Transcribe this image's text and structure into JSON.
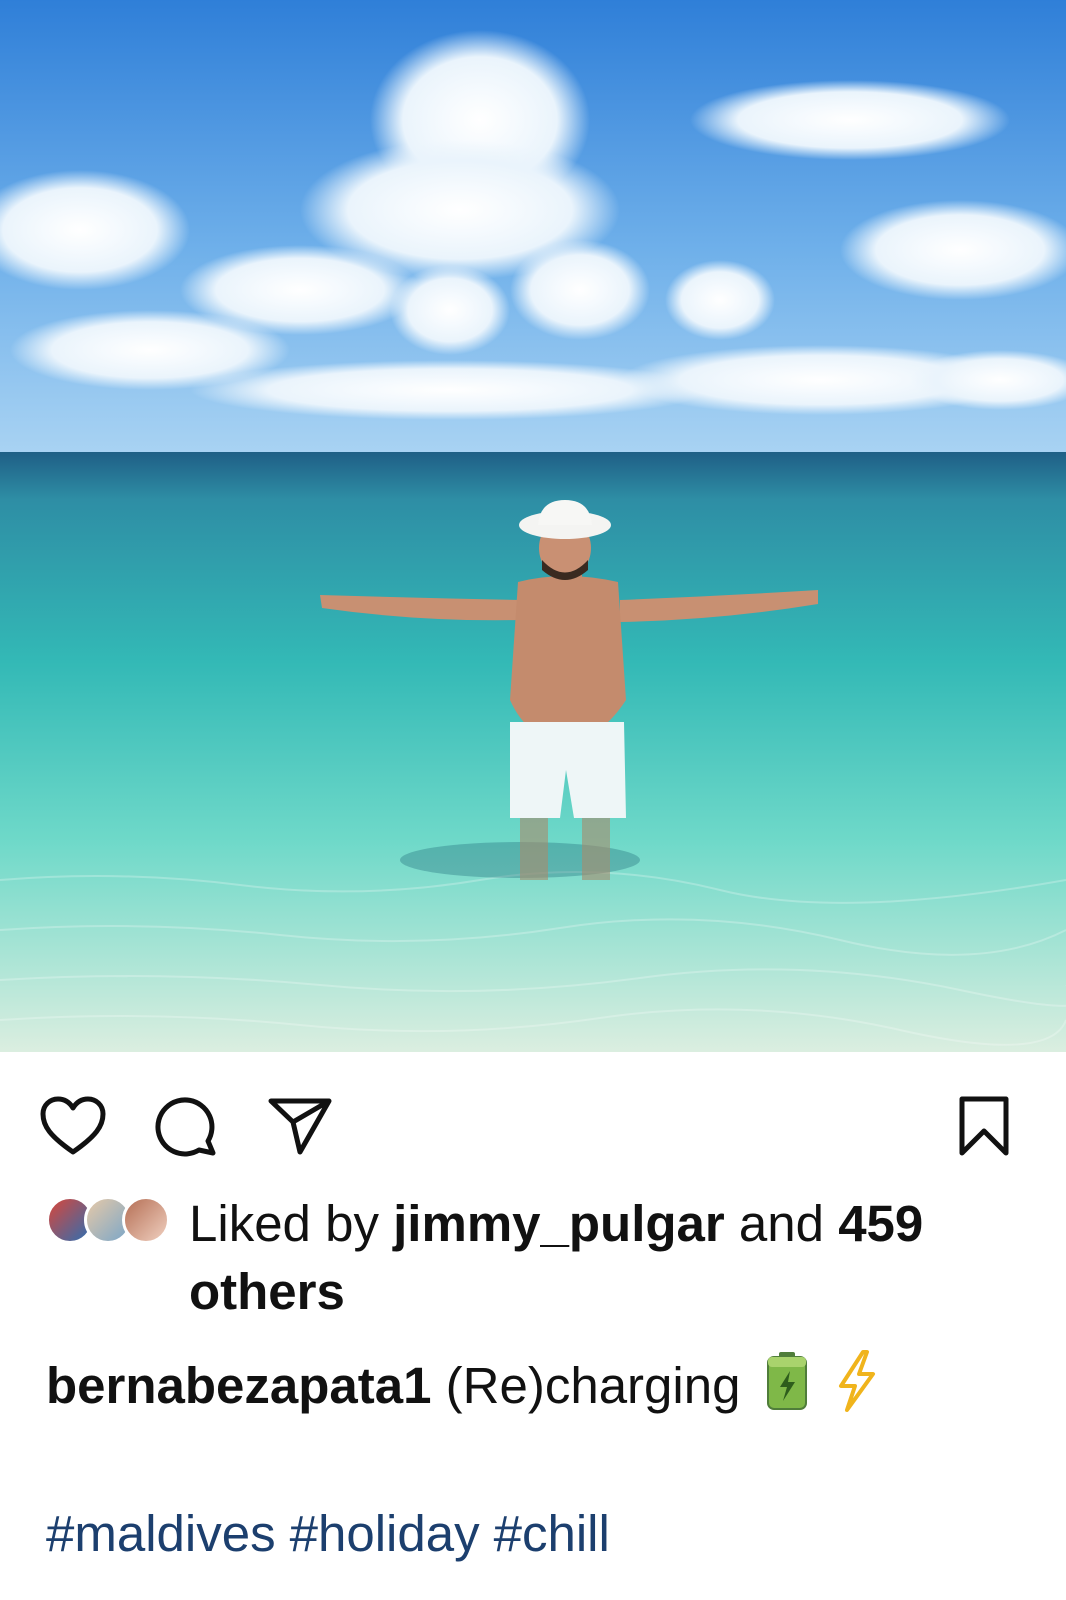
{
  "post": {
    "image_alt": "man in white hat standing in turquoise sea with arms outstretched"
  },
  "actions": {
    "like_icon": "heart-icon",
    "comment_icon": "comment-icon",
    "share_icon": "send-icon",
    "save_icon": "bookmark-icon"
  },
  "likes": {
    "prefix": "Liked by",
    "user": "jimmy_pulgar",
    "connector": "and",
    "count": "459",
    "suffix": "others"
  },
  "caption": {
    "username": "bernabezapata1",
    "text": "(Re)charging",
    "emojis": [
      "battery-icon",
      "lightning-icon"
    ]
  },
  "hashtags": [
    "#maldives",
    "#holiday",
    "#chill"
  ],
  "colors": {
    "hashtag": "#1c3f6e",
    "text": "#111111",
    "background": "#ffffff"
  }
}
